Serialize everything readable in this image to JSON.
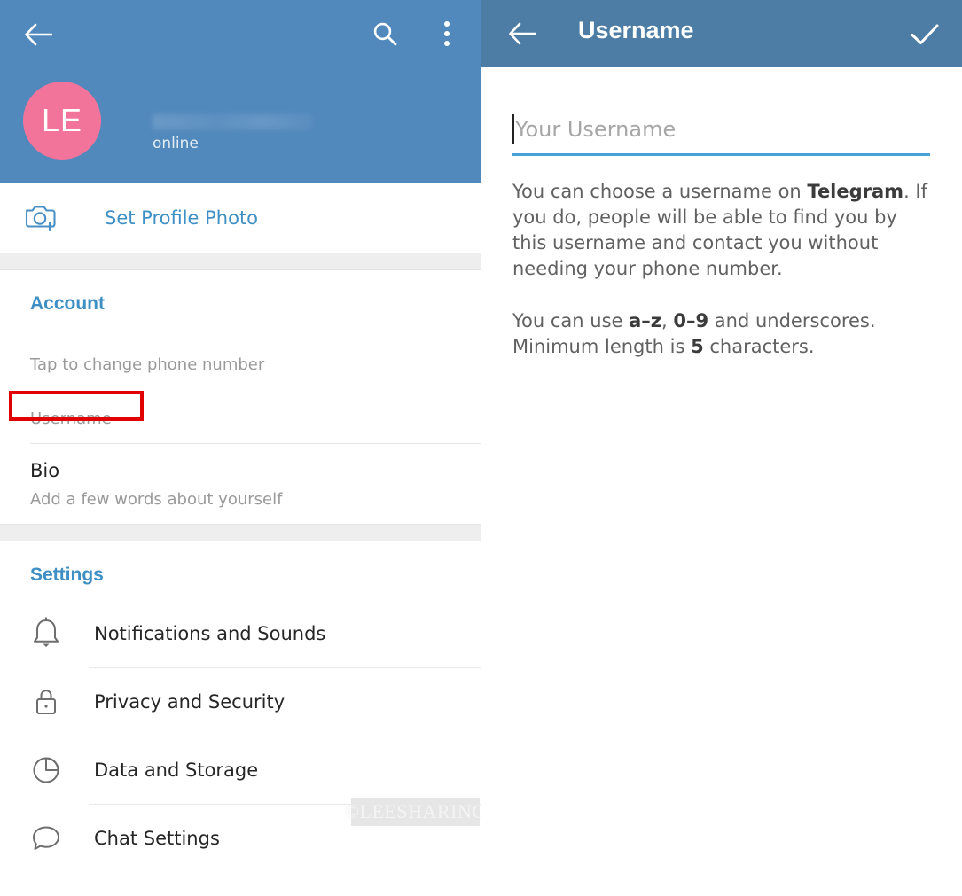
{
  "left_panel": {
    "header": {
      "back_icon": "back-arrow-icon",
      "search_icon": "search-icon",
      "overflow_icon": "more-vertical-icon",
      "avatar_initials": "LE",
      "avatar_color": "#f2749b",
      "header_color": "#5289bd",
      "status": "online",
      "display_name": ""
    },
    "set_profile_photo": {
      "icon": "camera-add-icon",
      "label": "Set Profile Photo",
      "color": "#3e8fc4"
    },
    "account_section": {
      "title": "Account",
      "rows": [
        {
          "main": "",
          "sub": "Tap to change phone number"
        },
        {
          "main": "",
          "sub": "Username"
        },
        {
          "main": "Bio",
          "sub": "Add a few words about yourself"
        }
      ]
    },
    "settings_section": {
      "title": "Settings",
      "items": [
        {
          "icon": "bell-icon",
          "label": "Notifications and Sounds"
        },
        {
          "icon": "lock-icon",
          "label": "Privacy and Security"
        },
        {
          "icon": "pie-chart-icon",
          "label": "Data and Storage"
        },
        {
          "icon": "chat-bubble-icon",
          "label": "Chat Settings"
        }
      ]
    },
    "highlight": {
      "target": "Username",
      "color": "#e00000"
    },
    "watermark": "©LEESHARING"
  },
  "right_panel": {
    "header": {
      "back_icon": "back-arrow-icon",
      "title": "Username",
      "confirm_icon": "check-icon",
      "header_color": "#4d7da5"
    },
    "input": {
      "value": "",
      "placeholder": "Your Username",
      "underline_color": "#46a3d8"
    },
    "help": {
      "paragraph1_part1": "You can choose a username on ",
      "paragraph1_bold1": "Telegram",
      "paragraph1_part2": ". If you do, people will be able to find you by this username and contact you without needing your phone number.",
      "paragraph2_part1": "You can use ",
      "paragraph2_bold1": "a–z",
      "paragraph2_part2": ", ",
      "paragraph2_bold2": "0–9",
      "paragraph2_part3": " and underscores. Minimum length is ",
      "paragraph2_bold3": "5",
      "paragraph2_part4": " characters."
    }
  }
}
